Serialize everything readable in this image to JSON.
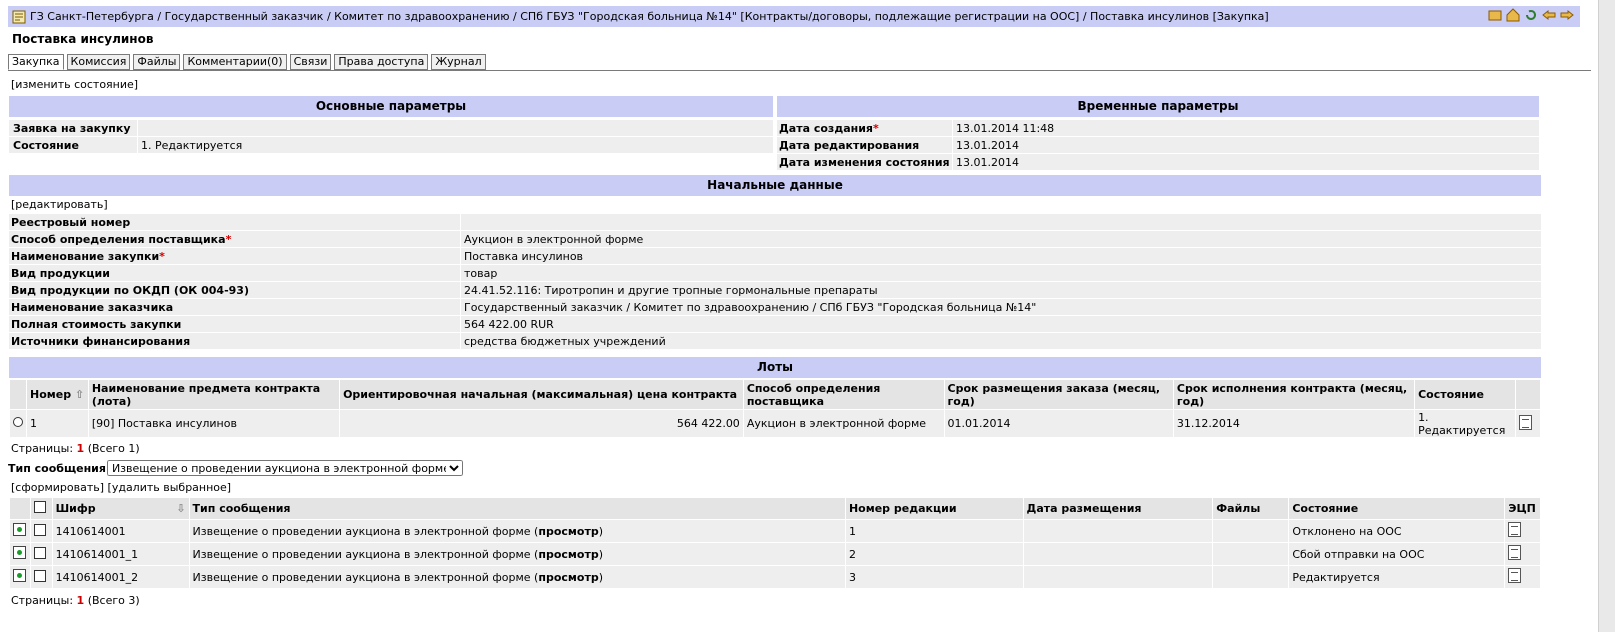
{
  "breadcrumb": "ГЗ Санкт-Петербурга / Государственный заказчик / Комитет по здравоохранению / СПб ГБУЗ \"Городская больница №14\" [Контракты/договоры, подлежащие регистрации на ООС] / Поставка инсулинов [Закупка]",
  "page_title": "Поставка инсулинов",
  "tabs": [
    "Закупка",
    "Комиссия",
    "Файлы",
    "Комментарии(0)",
    "Связи",
    "Права доступа",
    "Журнал"
  ],
  "change_state_link": "[изменить состояние]",
  "main_params": {
    "title": "Основные параметры",
    "rows": [
      {
        "label": "Заявка на закупку",
        "value": ""
      },
      {
        "label": "Состояние",
        "value": "1. Редактируется"
      }
    ]
  },
  "time_params": {
    "title": "Временные параметры",
    "rows": [
      {
        "label": "Дата создания",
        "required": "*",
        "value": "13.01.2014 11:48"
      },
      {
        "label": "Дата редактирования",
        "required": "",
        "value": "13.01.2014"
      },
      {
        "label": "Дата изменения состояния",
        "required": "",
        "value": "13.01.2014"
      }
    ]
  },
  "initial_data": {
    "title": "Начальные данные",
    "edit_link": "[редактировать]",
    "rows": [
      {
        "label": "Реестровый номер",
        "required": "",
        "value": ""
      },
      {
        "label": "Способ определения поставщика",
        "required": "*",
        "value": "Аукцион в электронной форме"
      },
      {
        "label": "Наименование закупки",
        "required": "*",
        "value": "Поставка инсулинов"
      },
      {
        "label": "Вид продукции",
        "required": "",
        "value": "товар"
      },
      {
        "label": "Вид продукции по ОКДП (ОК 004-93)",
        "required": "",
        "value": "24.41.52.116: Тиротропин и другие тропные гормональные препараты"
      },
      {
        "label": "Наименование заказчика",
        "required": "",
        "value": "Государственный заказчик / Комитет по здравоохранению / СПб ГБУЗ \"Городская больница №14\""
      },
      {
        "label": "Полная стоимость закупки",
        "required": "",
        "value": "564 422.00 RUR"
      },
      {
        "label": "Источники финансирования",
        "required": "",
        "value": "средства бюджетных учреждений"
      }
    ]
  },
  "lots": {
    "title": "Лоты",
    "headers": [
      "Номер",
      "Наименование предмета контракта (лота)",
      "Ориентировочная начальная (максимальная) цена контракта",
      "Способ определения поставщика",
      "Срок размещения заказа (месяц, год)",
      "Срок исполнения контракта (месяц, год)",
      "Состояние"
    ],
    "rows": [
      {
        "num": "1",
        "name": "[90] Поставка инсулинов",
        "price": "564 422.00",
        "method": "Аукцион в электронной форме",
        "place_date": "01.01.2014",
        "exec_date": "31.12.2014",
        "state": "1. Редактируется"
      }
    ],
    "pages_label": "Страницы:",
    "pages_current": "1",
    "pages_total": "(Всего 1)"
  },
  "message_type": {
    "label": "Тип сообщения",
    "selected": "Извещение о проведении аукциона в электронной форме"
  },
  "actions": {
    "form": "[сформировать]",
    "delete": "[удалить выбранное]"
  },
  "messages": {
    "headers": [
      "Шифр",
      "Тип сообщения",
      "Номер редакции",
      "Дата размещения",
      "Файлы",
      "Состояние",
      "ЭЦП"
    ],
    "view_label": "просмотр",
    "rows": [
      {
        "code": "1410614001",
        "type": "Извещение о проведении аукциона в электронной форме",
        "rev": "1",
        "date": "",
        "files": "",
        "state": "Отклонено на ООС"
      },
      {
        "code": "1410614001_1",
        "type": "Извещение о проведении аукциона в электронной форме",
        "rev": "2",
        "date": "",
        "files": "",
        "state": "Сбой отправки на ООС"
      },
      {
        "code": "1410614001_2",
        "type": "Извещение о проведении аукциона в электронной форме",
        "rev": "3",
        "date": "",
        "files": "",
        "state": "Редактируется"
      }
    ],
    "pages_label": "Страницы:",
    "pages_current": "1",
    "pages_total": "(Всего 3)"
  }
}
